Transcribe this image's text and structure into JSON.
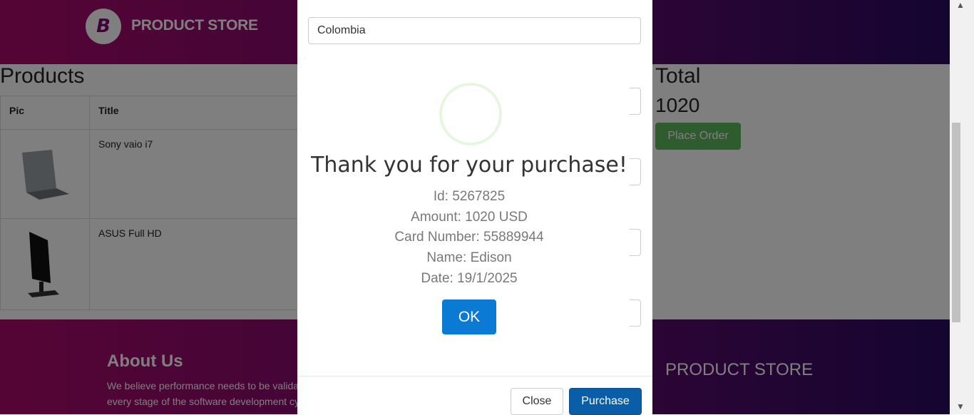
{
  "header": {
    "logo_letter": "B",
    "brand": "PRODUCT STORE"
  },
  "products": {
    "title": "Products",
    "columns": [
      "Pic",
      "Title"
    ],
    "rows": [
      {
        "title": "Sony vaio i7",
        "pic": "laptop-image"
      },
      {
        "title": "ASUS Full HD",
        "pic": "monitor-image"
      }
    ]
  },
  "total": {
    "label": "Total",
    "value": "1020",
    "place_order": "Place Order"
  },
  "footer": {
    "about_title": "About Us",
    "about_text": "We believe performance needs to be validated at every stage of the software development cycle a",
    "brand": "PRODUCT STORE"
  },
  "modal": {
    "country_value": "Colombia",
    "close": "Close",
    "purchase": "Purchase"
  },
  "confirm": {
    "title": "Thank you for your purchase!",
    "lines": [
      "Id: 5267825",
      "Amount: 1020 USD",
      "Card Number: 55889944",
      "Name: Edison",
      "Date: 19/1/2025"
    ],
    "ok": "OK"
  },
  "colors": {
    "header_start": "#ab0a6b",
    "header_end": "#2a0a62",
    "primary": "#0a5ea8",
    "success": "#5cb85c"
  }
}
